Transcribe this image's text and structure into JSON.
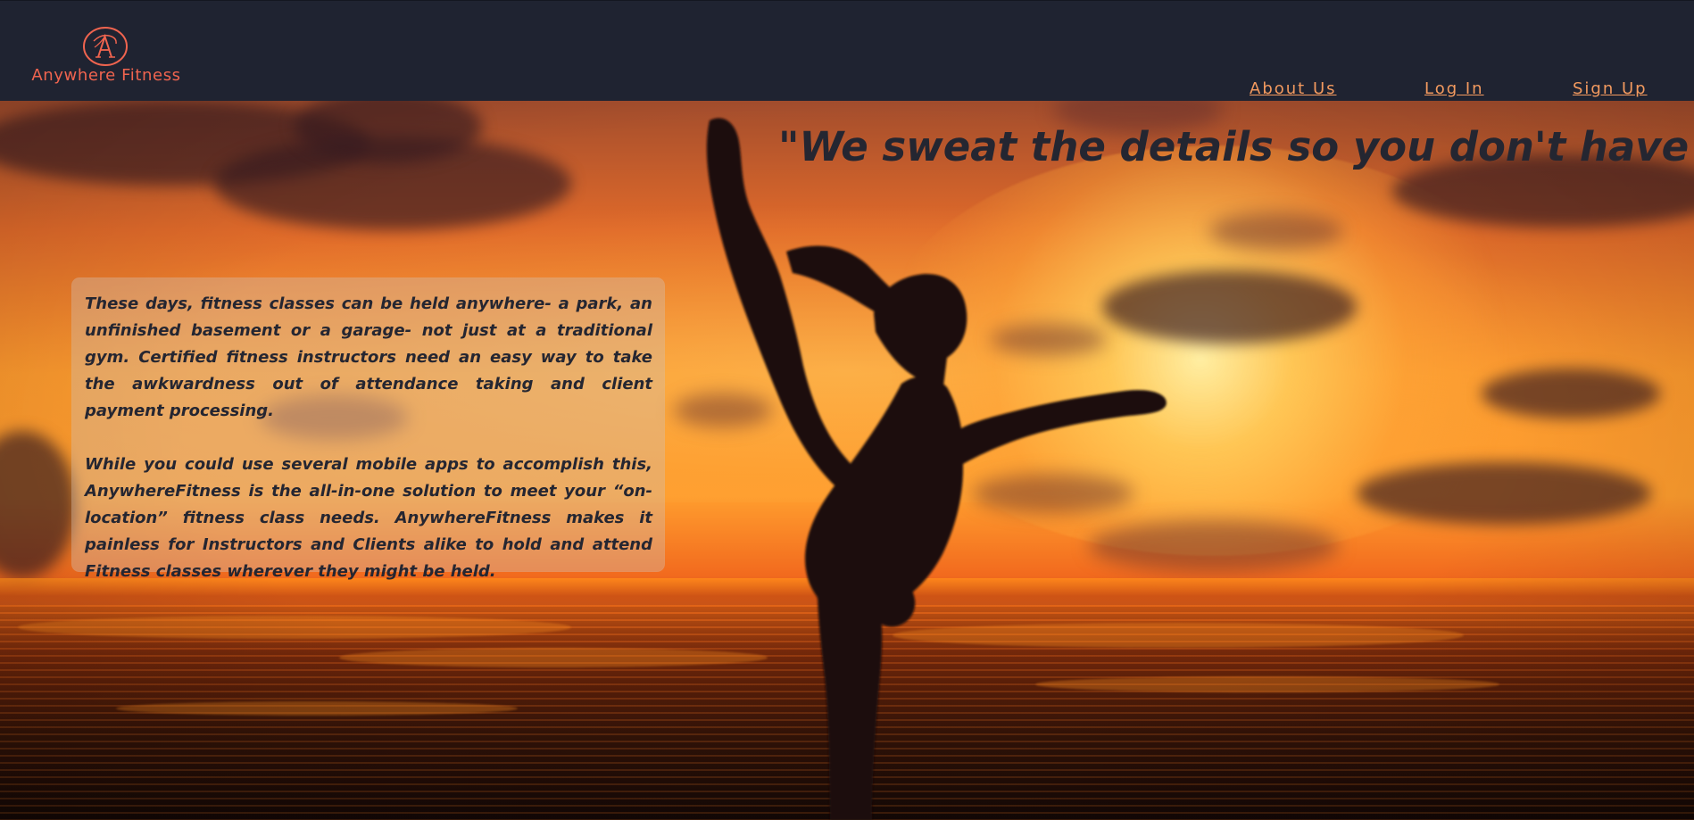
{
  "brand": {
    "name": "Anywhere Fitness",
    "logo_icon": "fitness-a-logo-icon",
    "logo_letter": "A"
  },
  "nav": {
    "items": [
      {
        "label": "About Us"
      },
      {
        "label": "Log In"
      },
      {
        "label": "Sign Up"
      }
    ]
  },
  "hero": {
    "headline": "\"We sweat the details so you don't have to!\"",
    "paragraphs": [
      "These days, fitness classes can be held anywhere- a park, an unfinished basement or a garage- not just at a traditional gym. Certified fitness instructors need an easy way to take the awkwardness out of attendance taking and client payment processing.",
      "While you could use several mobile apps to accomplish this, AnywhereFitness is the all-in-one solution to meet your “on-location” fitness class needs. AnywhereFitness makes it painless for Instructors and Clients alike to hold and attend Fitness classes wherever they might be held."
    ],
    "background_image": "sunset-yoga-silhouette-image"
  },
  "colors": {
    "header_background": "#1f2331",
    "brand_accent": "#f0644f",
    "nav_link": "#f39a5f",
    "headline_text": "#242631",
    "sunset_orange": "#fb982d"
  }
}
